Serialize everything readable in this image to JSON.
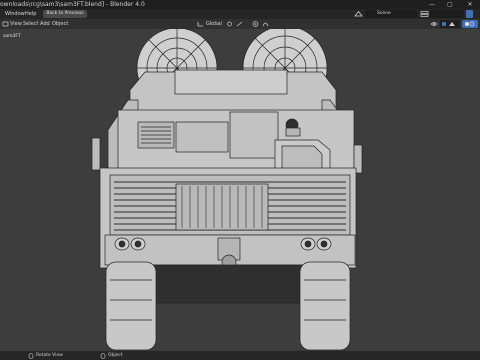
{
  "window": {
    "title": "ownloads\\rcg\\sam3\\sam3FT.blend] - Blender 4.0",
    "controls": [
      "—",
      "▢",
      "✕"
    ]
  },
  "menu": {
    "items": [
      "Window",
      "Help"
    ],
    "back_button": "Back to Previous",
    "scene_label": "Scene"
  },
  "header": {
    "items": [
      "View",
      "Select",
      "Add",
      "Object"
    ],
    "transform_orientation": "Global"
  },
  "viewport": {
    "overlay_label": "sam3FT"
  },
  "statusbar": {
    "items": [
      "Rotate View",
      "Object"
    ]
  },
  "colors": {
    "accent": "#3f6fb6",
    "viewport_bg": "#3d3d3d",
    "model": "#c7c7c7"
  }
}
